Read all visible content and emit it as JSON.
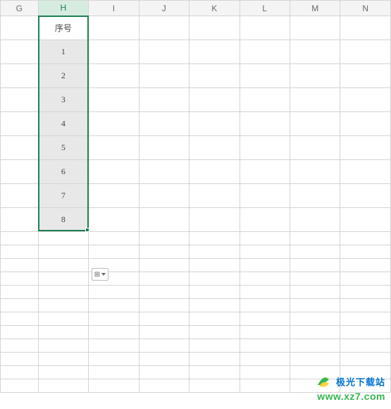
{
  "columns": [
    {
      "letter": "G",
      "active": false,
      "cls": "col-G"
    },
    {
      "letter": "H",
      "active": true,
      "cls": "col-H"
    },
    {
      "letter": "I",
      "active": false,
      "cls": "col-std"
    },
    {
      "letter": "J",
      "active": false,
      "cls": "col-std"
    },
    {
      "letter": "K",
      "active": false,
      "cls": "col-std"
    },
    {
      "letter": "L",
      "active": false,
      "cls": "col-std"
    },
    {
      "letter": "M",
      "active": false,
      "cls": "col-std"
    },
    {
      "letter": "N",
      "active": false,
      "cls": "col-std"
    }
  ],
  "headerCell": "序号",
  "numbers": [
    "1",
    "2",
    "3",
    "4",
    "5",
    "6",
    "7",
    "8"
  ],
  "autofill_icon": "⊞",
  "watermark": {
    "title": "极光下载站",
    "url": "www.xz7.com"
  },
  "colors": {
    "selection": "#1c8052",
    "fill": "#e8e8e8"
  }
}
